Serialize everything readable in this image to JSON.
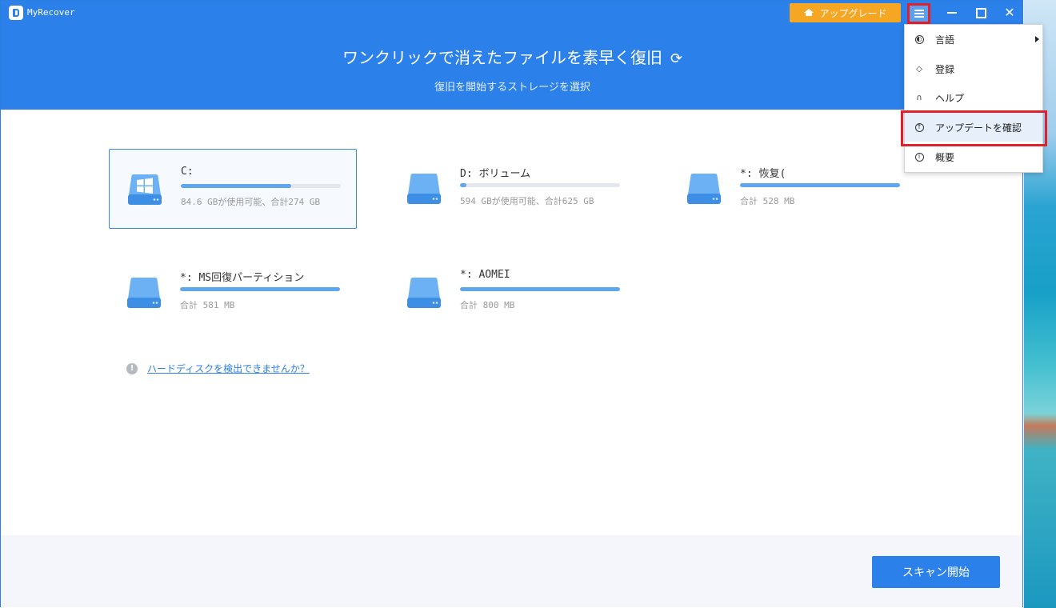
{
  "app": {
    "name": "MyRecover",
    "upgrade_label": "アップグレード"
  },
  "header": {
    "title": "ワンクリックで消えたファイルを素早く復旧",
    "subtitle": "復旧を開始するストレージを選択"
  },
  "drives": [
    {
      "name": "C:",
      "info": "84.6 GBが使用可能、合計274 GB",
      "used_fraction": 0.69,
      "selected": true,
      "windows": true
    },
    {
      "name": "D: ボリューム",
      "info": "594 GBが使用可能、合計625 GB",
      "used_fraction": 0.04,
      "selected": false,
      "windows": false
    },
    {
      "name": "*: 恢复(",
      "info": "合計 528 MB",
      "used_fraction": 1.0,
      "selected": false,
      "windows": false
    },
    {
      "name": "*: MS回復パーティション",
      "info": "合計 581 MB",
      "used_fraction": 1.0,
      "selected": false,
      "windows": false
    },
    {
      "name": "*: AOMEI",
      "info": "合計 800 MB",
      "used_fraction": 1.0,
      "selected": false,
      "windows": false
    }
  ],
  "help": {
    "link_text": "ハードディスクを検出できませんか？"
  },
  "footer": {
    "scan_label": "スキャン開始"
  },
  "menu": {
    "items": [
      {
        "label": "言語",
        "icon": "globe-icon"
      },
      {
        "label": "登録",
        "icon": "diamond-icon"
      },
      {
        "label": "ヘルプ",
        "icon": "headset-icon"
      },
      {
        "label": "アップデートを確認",
        "icon": "arrow-up-circle-icon"
      },
      {
        "label": "概要",
        "icon": "info-icon"
      }
    ]
  },
  "colors": {
    "primary": "#2c80ea",
    "upgrade": "#f5a623",
    "highlight_outline": "#e0202a"
  }
}
